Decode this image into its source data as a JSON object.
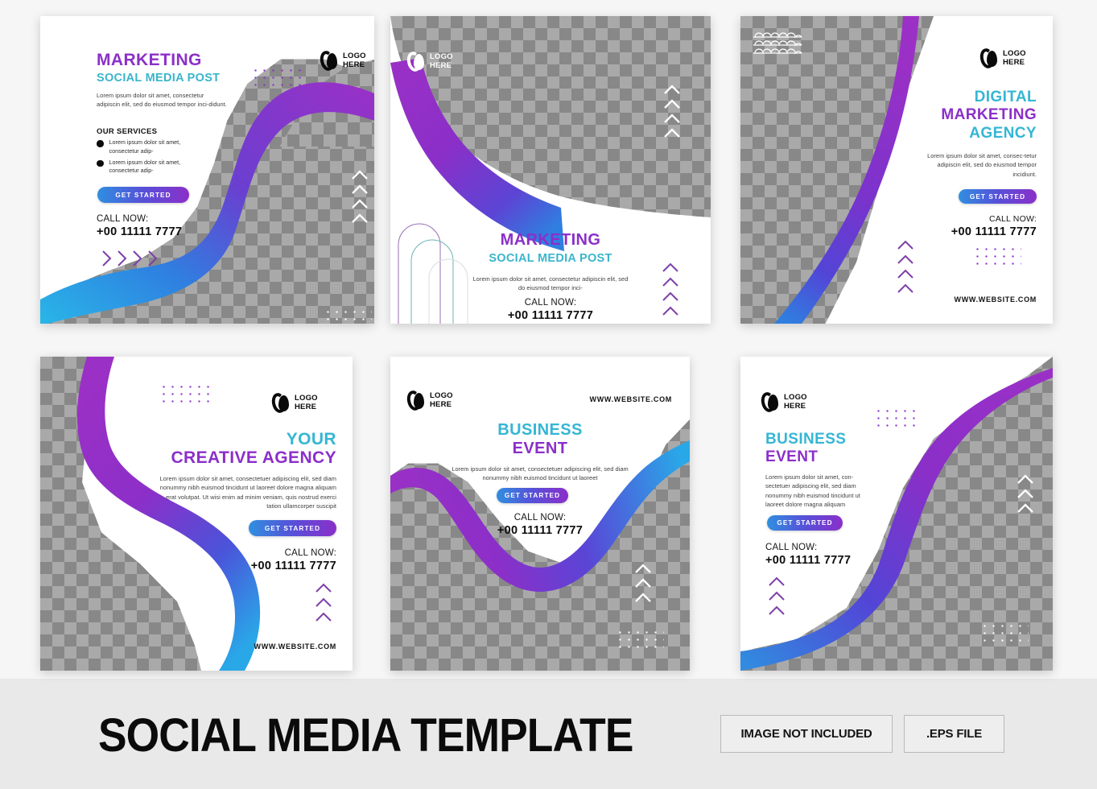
{
  "meta": {
    "bg_color": "#f6f6f6",
    "banner_bg": "#e9e9e9",
    "accent_purple": "#8b2fc9",
    "accent_teal": "#3ab5cc",
    "accent_blue": "#2f8fe0"
  },
  "logo": {
    "line1": "LOGO",
    "line2": "HERE"
  },
  "common": {
    "get_started": "GET STARTED",
    "call_now": "CALL NOW:",
    "phone": "+00 11111 7777",
    "website": "WWW.WEBSITE.COM"
  },
  "cards": [
    {
      "id": "marketing-social-media-post",
      "title_line1": "MARKETING",
      "title_line2": "SOCIAL MEDIA POST",
      "paragraph": "Lorem ipsum dolor sit amet, consectetur adipiscin  elit, sed do eiusmod tempor inci-didunt.",
      "services_heading": "OUR SERVICES",
      "services": [
        "Lorem ipsum dolor sit amet, consectetur adip-",
        "Lorem ipsum dolor sit amet, consectetur adip-"
      ],
      "cta": "GET STARTED",
      "call_label": "CALL NOW:",
      "phone": "+00 11111 7777"
    },
    {
      "id": "marketing-social-media-post-2",
      "title_line1": "MARKETING",
      "title_line2": "SOCIAL MEDIA POST",
      "paragraph": "Lorem ipsum dolor sit amet, consectetur adipiscin  elit, sed do eiusmod tempor inci-",
      "call_label": "CALL NOW:",
      "phone": "+00 11111 7777"
    },
    {
      "id": "digital-marketing-agency",
      "title_line1": "DIGITAL",
      "title_line2": "MARKETING",
      "title_line3": "AGENCY",
      "paragraph": "Lorem ipsum dolor sit amet, consec-tetur adipiscin  elit, sed do eiusmod tempor incidiunt.",
      "cta": "GET STARTED",
      "call_label": "CALL NOW:",
      "phone": "+00 11111 7777",
      "website": "WWW.WEBSITE.COM"
    },
    {
      "id": "your-creative-agency",
      "title_line1": "YOUR",
      "title_line2": "CREATIVE AGENCY",
      "paragraph": "Lorem ipsum dolor sit amet, consectetuer adipiscing elit, sed diam nonummy nibh euismod tincidunt ut laoreet dolore magna aliquam erat volutpat. Ut wisi enim ad minim veniam, quis nostrud exerci tation ullamcorper suscipit",
      "cta": "GET STARTED",
      "call_label": "CALL NOW:",
      "phone": "+00 11111 7777",
      "website": "WWW.WEBSITE.COM"
    },
    {
      "id": "business-event-center",
      "website": "WWW.WEBSITE.COM",
      "title_line1": "BUSINESS",
      "title_line2": "EVENT",
      "paragraph": "Lorem ipsum dolor sit amet, consectetuer adipiscing elit, sed diam nonummy nibh euismod tincidunt ut laoreet",
      "cta": "GET STARTED",
      "call_label": "CALL NOW:",
      "phone": "+00 11111 7777"
    },
    {
      "id": "business-event-right",
      "title_line1": "BUSINESS",
      "title_line2": "EVENT",
      "paragraph": "Lorem ipsum dolor sit amet, con-sectetuer adipiscing elit, sed diam nonummy nibh euismod tincidunt ut laoreet dolore magna aliquam",
      "cta": "GET STARTED",
      "call_label": "CALL NOW:",
      "phone": "+00 11111 7777"
    }
  ],
  "banner": {
    "title": "SOCIAL MEDIA TEMPLATE",
    "tag_image": "IMAGE NOT INCLUDED",
    "tag_file": ".EPS FILE"
  }
}
